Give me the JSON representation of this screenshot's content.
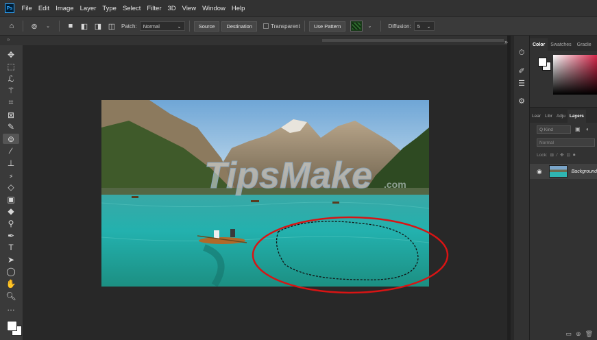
{
  "app": {
    "logo_text": "Ps"
  },
  "menu": [
    "File",
    "Edit",
    "Image",
    "Layer",
    "Type",
    "Select",
    "Filter",
    "3D",
    "View",
    "Window",
    "Help"
  ],
  "options": {
    "home_icon": "home-icon",
    "patch_label": "Patch:",
    "patch_mode": "Normal",
    "source_label": "Source",
    "destination_label": "Destination",
    "transparent_label": "Transparent",
    "use_pattern_label": "Use Pattern",
    "diffusion_label": "Diffusion:",
    "diffusion_value": "5"
  },
  "tools": [
    {
      "name": "move-tool-icon",
      "glyph": "✥"
    },
    {
      "name": "marquee-tool-icon",
      "glyph": "⬚"
    },
    {
      "name": "lasso-tool-icon",
      "glyph": "ℒ"
    },
    {
      "name": "magic-wand-tool-icon",
      "glyph": "⚚"
    },
    {
      "name": "crop-tool-icon",
      "glyph": "⌗"
    },
    {
      "name": "frame-tool-icon",
      "glyph": "⊠"
    },
    {
      "name": "eyedropper-tool-icon",
      "glyph": "✎"
    },
    {
      "name": "patch-tool-icon",
      "glyph": "⊚"
    },
    {
      "name": "brush-tool-icon",
      "glyph": "∕"
    },
    {
      "name": "stamp-tool-icon",
      "glyph": "⊥"
    },
    {
      "name": "history-brush-tool-icon",
      "glyph": "⸗"
    },
    {
      "name": "eraser-tool-icon",
      "glyph": "◇"
    },
    {
      "name": "gradient-tool-icon",
      "glyph": "▣"
    },
    {
      "name": "blur-tool-icon",
      "glyph": "◆"
    },
    {
      "name": "dodge-tool-icon",
      "glyph": "⚲"
    },
    {
      "name": "pen-tool-icon",
      "glyph": "✒"
    },
    {
      "name": "type-tool-icon",
      "glyph": "T"
    },
    {
      "name": "path-select-tool-icon",
      "glyph": "➤"
    },
    {
      "name": "shape-tool-icon",
      "glyph": "◯"
    },
    {
      "name": "hand-tool-icon",
      "glyph": "✋"
    },
    {
      "name": "zoom-tool-icon",
      "glyph": "🔍︎"
    },
    {
      "name": "more-tools-icon",
      "glyph": "…"
    }
  ],
  "color_panel": {
    "tabs": [
      "Color",
      "Swatches",
      "Gradie"
    ],
    "active_tab": "Color",
    "accent_color": "#d6264a"
  },
  "layers_panel": {
    "tabs": [
      "Lear",
      "Libr",
      "Adju",
      "Layers"
    ],
    "active_tab": "Layers",
    "kind_placeholder": "Q Kind",
    "blend_mode": "Normal",
    "lock_label": "Lock:",
    "layer_name": "Background"
  },
  "image": {
    "watermark": "TipsMake",
    "watermark_suffix": ".com",
    "selection_ellipse_color": "#d81414"
  }
}
